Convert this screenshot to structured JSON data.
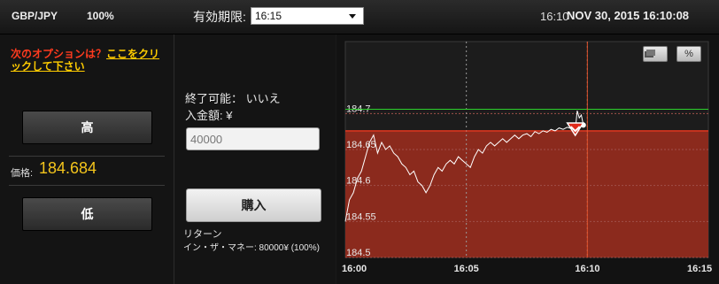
{
  "header": {
    "pair": "GBP/JPY",
    "percent": "100%",
    "expiry_label": "有効期限:",
    "expiry_value": "16:15",
    "time_short": "16:10",
    "datetime": "NOV 30, 2015 16:10:08"
  },
  "left": {
    "next_option_text": "次のオプションは？",
    "next_option_link": "ここをクリックして下さい",
    "high_label": "高",
    "price_label": "価格:",
    "price_value": "184.684",
    "low_label": "低"
  },
  "middle": {
    "end_possible": "終了可能： いいえ",
    "deposit_label": "入金額: ¥",
    "amount_value": "40000",
    "buy_label": "購入",
    "return_label": "リターン",
    "itm_label": "イン・ザ・マネー: 80000¥ (100%)"
  },
  "chart_data": {
    "type": "line",
    "ylim": [
      184.5,
      184.8
    ],
    "y_ticks": [
      "184.7",
      "184.65",
      "184.6",
      "184.55",
      "184.5"
    ],
    "x_ticks": [
      "16:00",
      "16:05",
      "16:10",
      "16:15"
    ],
    "x_range": [
      "16:00",
      "16:15"
    ],
    "entry_price": 184.677,
    "buy_level": 184.706,
    "entry_time": "16:09:30",
    "current_time": "16:10",
    "direction": "low",
    "series": [
      {
        "points": [
          [
            "16:00:00",
            184.55
          ],
          [
            "16:00:10",
            184.58
          ],
          [
            "16:00:20",
            184.59
          ],
          [
            "16:00:30",
            184.61
          ],
          [
            "16:00:40",
            184.62
          ],
          [
            "16:00:50",
            184.64
          ],
          [
            "16:01:00",
            184.66
          ],
          [
            "16:01:10",
            184.67
          ],
          [
            "16:01:20",
            184.645
          ],
          [
            "16:01:30",
            184.66
          ],
          [
            "16:01:40",
            184.65
          ],
          [
            "16:01:50",
            184.655
          ],
          [
            "16:02:00",
            184.645
          ],
          [
            "16:02:10",
            184.64
          ],
          [
            "16:02:20",
            184.63
          ],
          [
            "16:02:30",
            184.625
          ],
          [
            "16:02:40",
            184.615
          ],
          [
            "16:02:50",
            184.62
          ],
          [
            "16:03:00",
            184.605
          ],
          [
            "16:03:10",
            184.6
          ],
          [
            "16:03:20",
            184.59
          ],
          [
            "16:03:30",
            184.6
          ],
          [
            "16:03:40",
            184.615
          ],
          [
            "16:03:50",
            184.625
          ],
          [
            "16:04:00",
            184.62
          ],
          [
            "16:04:10",
            184.63
          ],
          [
            "16:04:20",
            184.635
          ],
          [
            "16:04:30",
            184.63
          ],
          [
            "16:04:40",
            184.64
          ],
          [
            "16:04:50",
            184.635
          ],
          [
            "16:05:00",
            184.63
          ],
          [
            "16:05:10",
            184.625
          ],
          [
            "16:05:20",
            184.64
          ],
          [
            "16:05:30",
            184.65
          ],
          [
            "16:05:40",
            184.645
          ],
          [
            "16:05:50",
            184.655
          ],
          [
            "16:06:00",
            184.66
          ],
          [
            "16:06:10",
            184.655
          ],
          [
            "16:06:20",
            184.66
          ],
          [
            "16:06:30",
            184.665
          ],
          [
            "16:06:40",
            184.66
          ],
          [
            "16:06:50",
            184.665
          ],
          [
            "16:07:00",
            184.67
          ],
          [
            "16:07:10",
            184.665
          ],
          [
            "16:07:20",
            184.67
          ],
          [
            "16:07:30",
            184.672
          ],
          [
            "16:07:40",
            184.668
          ],
          [
            "16:07:50",
            184.675
          ],
          [
            "16:08:00",
            184.672
          ],
          [
            "16:08:10",
            184.676
          ],
          [
            "16:08:20",
            184.674
          ],
          [
            "16:08:30",
            184.678
          ],
          [
            "16:08:40",
            184.676
          ],
          [
            "16:08:50",
            184.68
          ],
          [
            "16:09:00",
            184.678
          ],
          [
            "16:09:10",
            184.681
          ],
          [
            "16:09:20",
            184.679
          ],
          [
            "16:09:30",
            184.677
          ],
          [
            "16:09:35",
            184.704
          ],
          [
            "16:09:40",
            184.694
          ],
          [
            "16:09:45",
            184.698
          ],
          [
            "16:09:50",
            184.684
          ]
        ]
      }
    ],
    "grid": true
  },
  "colors": {
    "accent_red": "#8b2a1d",
    "price_yellow": "#f3c41c",
    "link_yellow": "#ffcc00",
    "alert_red": "#ff3b1f",
    "buy_line_green": "#2bd12b"
  },
  "icons": {
    "chart_type": "window-icon",
    "percent": "percent-icon"
  }
}
